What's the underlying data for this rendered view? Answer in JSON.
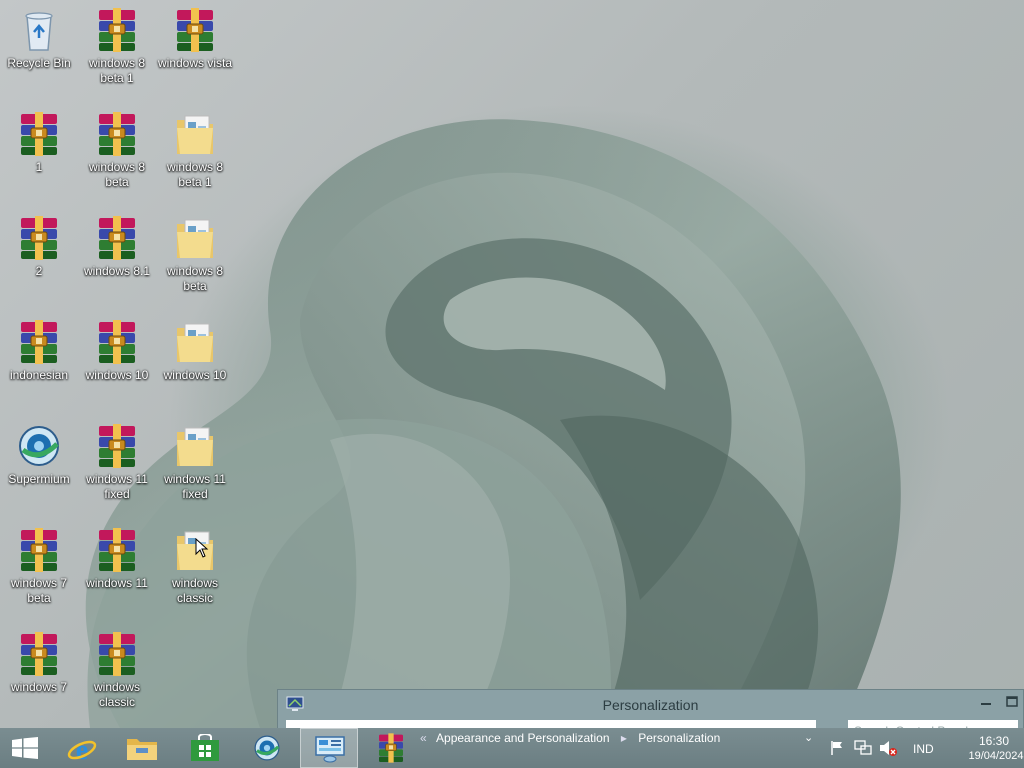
{
  "desktop": {
    "icons": [
      {
        "label": "Recycle Bin",
        "type": "recycle-bin"
      },
      {
        "label": "windows 8 beta 1",
        "type": "archive"
      },
      {
        "label": "windows vista",
        "type": "archive"
      },
      {
        "label": "1",
        "type": "archive"
      },
      {
        "label": "windows 8 beta",
        "type": "archive"
      },
      {
        "label": "windows 8 beta 1",
        "type": "folder"
      },
      {
        "label": "2",
        "type": "archive"
      },
      {
        "label": "windows 8.1",
        "type": "archive"
      },
      {
        "label": "windows 8 beta",
        "type": "folder"
      },
      {
        "label": "indonesian",
        "type": "archive"
      },
      {
        "label": "windows 10",
        "type": "archive"
      },
      {
        "label": "windows 10",
        "type": "folder"
      },
      {
        "label": "Supermium",
        "type": "browser-shortcut"
      },
      {
        "label": "windows 11 fixed",
        "type": "archive"
      },
      {
        "label": "windows 11 fixed",
        "type": "folder"
      },
      {
        "label": "windows 7 beta",
        "type": "archive"
      },
      {
        "label": "windows 11",
        "type": "archive"
      },
      {
        "label": "windows classic",
        "type": "folder"
      },
      {
        "label": "windows 7",
        "type": "archive"
      },
      {
        "label": "windows classic",
        "type": "archive"
      }
    ]
  },
  "window": {
    "title": "Personalization",
    "breadcrumb": [
      "Appearance and Personalization",
      "Personalization"
    ],
    "search_placeholder": "Search Control Panel"
  },
  "taskbar": {
    "buttons": [
      {
        "name": "start",
        "icon": "windows-logo-icon"
      },
      {
        "name": "internet-explorer",
        "icon": "internet-explorer-icon"
      },
      {
        "name": "file-explorer",
        "icon": "folder-icon"
      },
      {
        "name": "store",
        "icon": "store-icon"
      },
      {
        "name": "supermium",
        "icon": "browser-icon"
      },
      {
        "name": "control-panel",
        "icon": "control-panel-icon",
        "active": true
      },
      {
        "name": "winrar",
        "icon": "archive-icon"
      }
    ],
    "tray": {
      "language": "IND",
      "time": "16:30",
      "date": "19/04/2024"
    }
  },
  "colors": {
    "taskbar": "#6f8286",
    "window_frame": "#8ba1a6"
  }
}
